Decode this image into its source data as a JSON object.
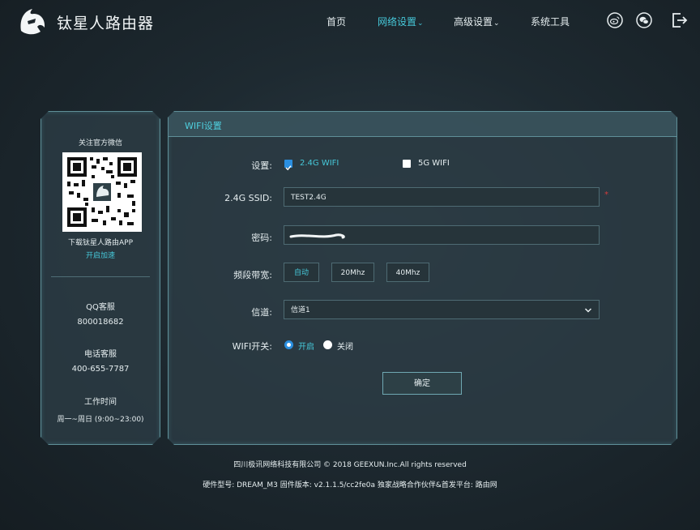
{
  "header": {
    "brand": "钛星人路由器",
    "nav": [
      {
        "label": "首页",
        "active": false,
        "caret": ""
      },
      {
        "label": "网络设置",
        "active": true,
        "caret": "⌄"
      },
      {
        "label": "高级设置",
        "active": false,
        "caret": "⌄"
      },
      {
        "label": "系统工具",
        "active": false,
        "caret": ""
      }
    ],
    "icons": [
      "weibo-icon",
      "wechat-icon",
      "logout-icon"
    ]
  },
  "sidebar": {
    "follow_wechat": "关注官方微信",
    "download_app": "下载钛星人路由APP",
    "speedup_link": "开启加速",
    "qq_title": "QQ客服",
    "qq_number": "800018682",
    "phone_title": "电话客服",
    "phone_number": "400-655-7787",
    "hours_title": "工作时间",
    "hours_value": "周一~周日 (9:00~23:00)"
  },
  "wifi": {
    "title": "WIFI设置",
    "setting_label": "设置:",
    "opt_24g": "2.4G WIFI",
    "opt_24g_checked": true,
    "opt_5g": "5G WIFI",
    "opt_5g_checked": false,
    "ssid_label": "2.4G SSID:",
    "ssid_value": "TEST2.4G",
    "required_mark": "*",
    "password_label": "密码:",
    "bandwidth_label": "频段带宽:",
    "bandwidth_options": [
      "自动",
      "20Mhz",
      "40Mhz"
    ],
    "bandwidth_selected": "自动",
    "channel_label": "信道:",
    "channel_value": "信道1",
    "switch_label": "WIFI开关:",
    "switch_on": "开启",
    "switch_off": "关闭",
    "switch_state": "on",
    "confirm": "确定"
  },
  "footer": {
    "line1": "四川极讯网络科技有限公司 © 2018 GEEXUN.Inc.All rights reserved",
    "line2": "硬件型号: DREAM_M3  固件版本: v2.1.1.5/cc2fe0a  独家战略合作伙伴&首发平台: 路由网"
  },
  "colors": {
    "accent": "#46c8d9",
    "checkbox_blue": "#2b8fe0",
    "required_red": "#d33b3b"
  }
}
